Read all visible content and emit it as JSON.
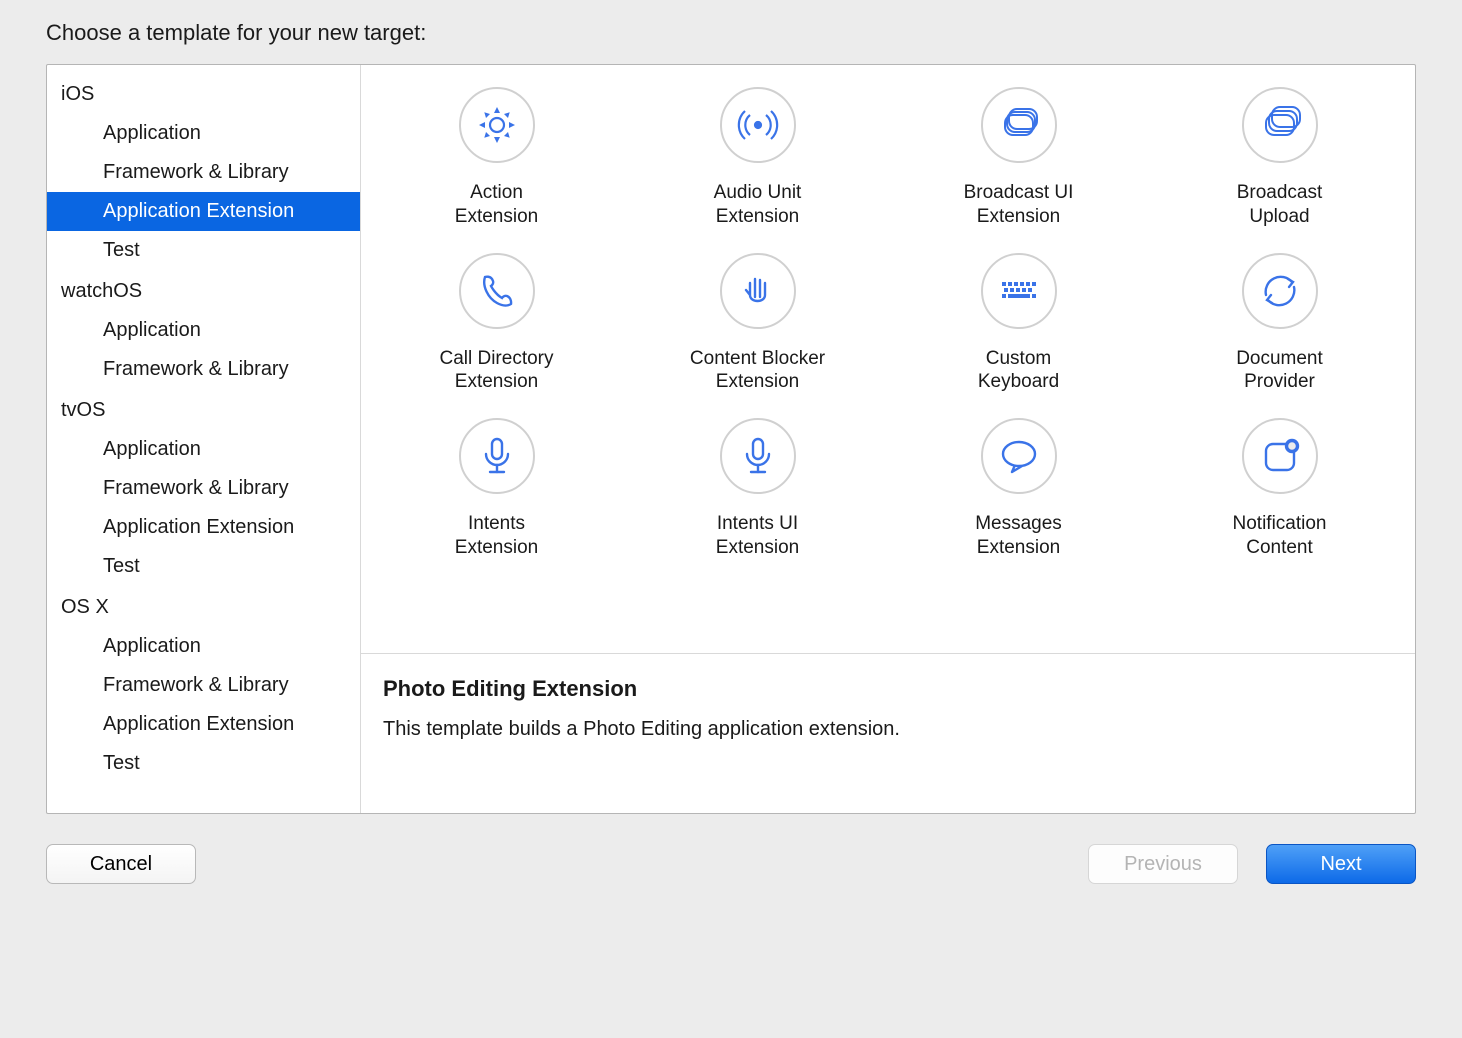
{
  "header": "Choose a template for your new target:",
  "sidebar": [
    {
      "type": "group",
      "label": "iOS"
    },
    {
      "type": "item",
      "label": "Application",
      "selected": false
    },
    {
      "type": "item",
      "label": "Framework & Library",
      "selected": false
    },
    {
      "type": "item",
      "label": "Application Extension",
      "selected": true
    },
    {
      "type": "item",
      "label": "Test",
      "selected": false
    },
    {
      "type": "group",
      "label": "watchOS"
    },
    {
      "type": "item",
      "label": "Application",
      "selected": false
    },
    {
      "type": "item",
      "label": "Framework & Library",
      "selected": false
    },
    {
      "type": "group",
      "label": "tvOS"
    },
    {
      "type": "item",
      "label": "Application",
      "selected": false
    },
    {
      "type": "item",
      "label": "Framework & Library",
      "selected": false
    },
    {
      "type": "item",
      "label": "Application Extension",
      "selected": false
    },
    {
      "type": "item",
      "label": "Test",
      "selected": false
    },
    {
      "type": "group",
      "label": "OS X"
    },
    {
      "type": "item",
      "label": "Application",
      "selected": false
    },
    {
      "type": "item",
      "label": "Framework & Library",
      "selected": false
    },
    {
      "type": "item",
      "label": "Application Extension",
      "selected": false
    },
    {
      "type": "item",
      "label": "Test",
      "selected": false
    }
  ],
  "templates": [
    {
      "label": "Action\nExtension",
      "icon": "gear-icon"
    },
    {
      "label": "Audio Unit\nExtension",
      "icon": "audio-icon"
    },
    {
      "label": "Broadcast UI\nExtension",
      "icon": "broadcast-ui-icon"
    },
    {
      "label": "Broadcast\nUpload",
      "icon": "broadcast-upload-icon"
    },
    {
      "label": "Call Directory\nExtension",
      "icon": "phone-icon"
    },
    {
      "label": "Content Blocker\nExtension",
      "icon": "hand-icon"
    },
    {
      "label": "Custom\nKeyboard",
      "icon": "keyboard-icon"
    },
    {
      "label": "Document\nProvider",
      "icon": "sync-icon"
    },
    {
      "label": "Intents\nExtension",
      "icon": "mic-icon"
    },
    {
      "label": "Intents UI\nExtension",
      "icon": "mic-icon"
    },
    {
      "label": "Messages\nExtension",
      "icon": "chat-icon"
    },
    {
      "label": "Notification\nContent",
      "icon": "notification-icon"
    }
  ],
  "description": {
    "title": "Photo Editing Extension",
    "body": "This template builds a Photo Editing application extension."
  },
  "buttons": {
    "cancel": "Cancel",
    "previous": "Previous",
    "next": "Next"
  }
}
